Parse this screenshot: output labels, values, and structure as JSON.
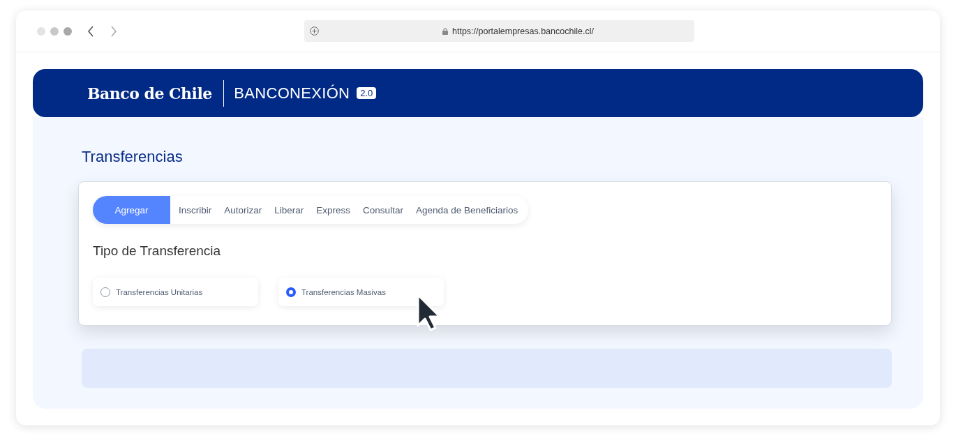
{
  "browser": {
    "url": "https://portalempresas.bancochile.cl/"
  },
  "header": {
    "logo": "Banco de Chile",
    "product": "BANCONEXIÓN",
    "version": "2.0"
  },
  "page_title": "Transferencias",
  "tabs": [
    {
      "label": "Agregar",
      "selected": true
    },
    {
      "label": "Inscribir",
      "selected": false
    },
    {
      "label": "Autorizar",
      "selected": false
    },
    {
      "label": "Liberar",
      "selected": false
    },
    {
      "label": "Express",
      "selected": false
    },
    {
      "label": "Consultar",
      "selected": false
    },
    {
      "label": "Agenda de Beneficiarios",
      "selected": false
    }
  ],
  "section_title": "Tipo de Transferencia",
  "options": [
    {
      "label": "Transferencias Unitarias",
      "selected": false
    },
    {
      "label": "Transferencias Masivas",
      "selected": true
    }
  ]
}
